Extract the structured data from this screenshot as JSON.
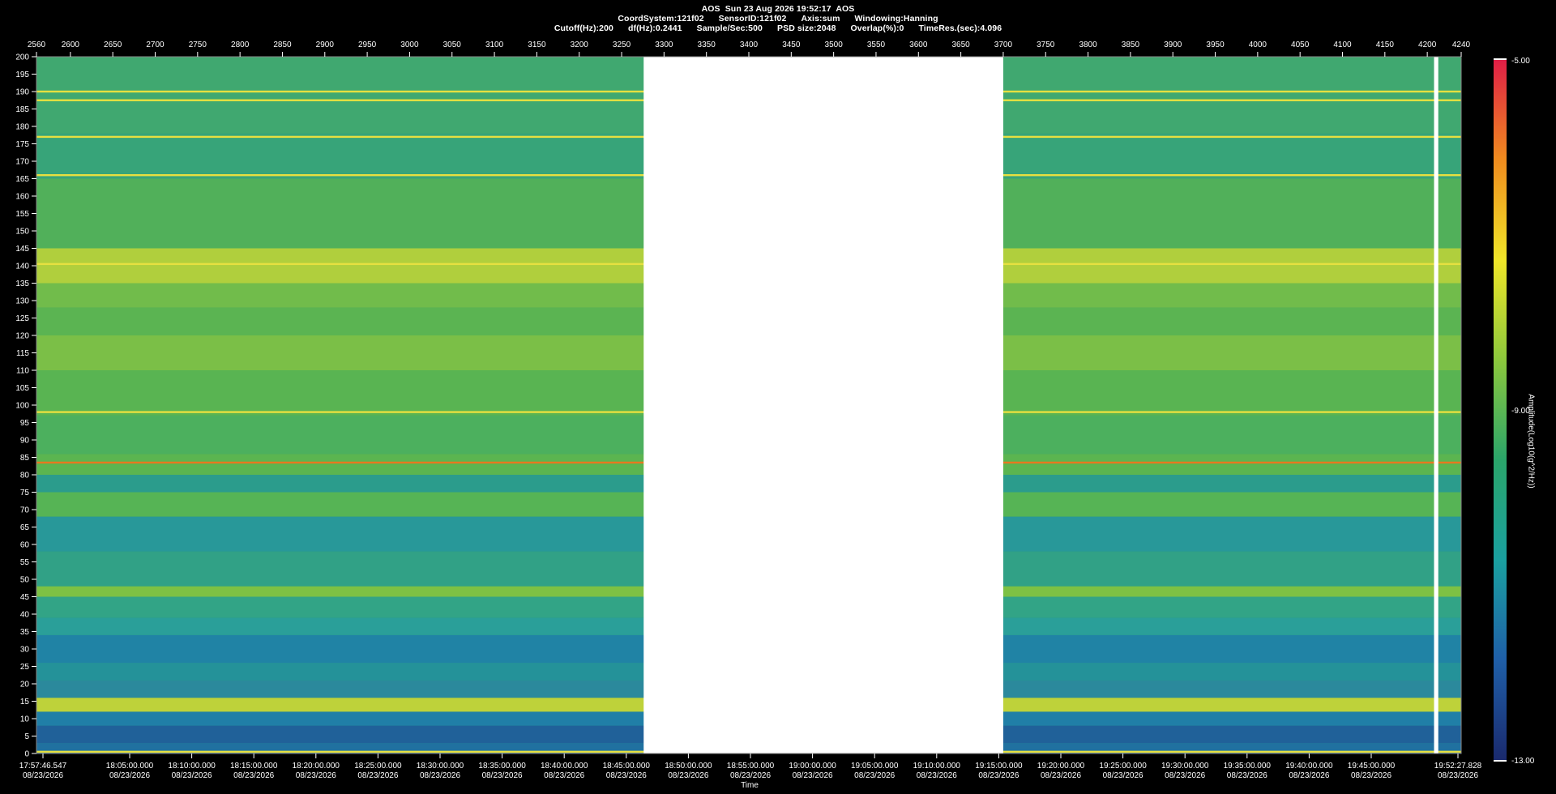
{
  "header": {
    "line1": [
      "AOS  Sun 23 Aug 2026 19:52:17  AOS"
    ],
    "line2": [
      "CoordSystem:121f02",
      "SensorID:121f02",
      "Axis:sum",
      "Windowing:Hanning"
    ],
    "line3": [
      "Cutoff(Hz):200",
      "df(Hz):0.2441",
      "Sample/Sec:500",
      "PSD size:2048",
      "Overlap(%):0",
      "TimeRes.(sec):4.096"
    ]
  },
  "chart_data": {
    "type": "heatmap",
    "title": "AOS  Sun 23 Aug 2026 19:52:17  AOS",
    "xlabel": "Time",
    "ylabel": "",
    "top_axis": {
      "range": [
        2560,
        4240
      ],
      "ticks": [
        2560,
        2600,
        2650,
        2700,
        2750,
        2800,
        2850,
        2900,
        2950,
        3000,
        3050,
        3100,
        3150,
        3200,
        3250,
        3300,
        3350,
        3400,
        3450,
        3500,
        3550,
        3600,
        3650,
        3700,
        3750,
        3800,
        3850,
        3900,
        3950,
        4000,
        4050,
        4100,
        4150,
        4200,
        4240
      ]
    },
    "y_axis": {
      "range": [
        0,
        200
      ],
      "ticks": [
        0,
        5,
        10,
        15,
        20,
        25,
        30,
        35,
        40,
        45,
        50,
        55,
        60,
        65,
        70,
        75,
        80,
        85,
        90,
        95,
        100,
        105,
        110,
        115,
        120,
        125,
        130,
        135,
        140,
        145,
        150,
        155,
        160,
        165,
        170,
        175,
        180,
        185,
        190,
        195,
        200
      ]
    },
    "x_axis": {
      "start_label": [
        "17:57:46.547",
        "08/23/2026"
      ],
      "end_label": [
        "19:52:27.828",
        "08/23/2026"
      ],
      "ticks": [
        [
          "18:05:00.000",
          "08/23/2026"
        ],
        [
          "18:10:00.000",
          "08/23/2026"
        ],
        [
          "18:15:00.000",
          "08/23/2026"
        ],
        [
          "18:20:00.000",
          "08/23/2026"
        ],
        [
          "18:25:00.000",
          "08/23/2026"
        ],
        [
          "18:30:00.000",
          "08/23/2026"
        ],
        [
          "18:35:00.000",
          "08/23/2026"
        ],
        [
          "18:40:00.000",
          "08/23/2026"
        ],
        [
          "18:45:00.000",
          "08/23/2026"
        ],
        [
          "18:50:00.000",
          "08/23/2026"
        ],
        [
          "18:55:00.000",
          "08/23/2026"
        ],
        [
          "19:00:00.000",
          "08/23/2026"
        ],
        [
          "19:05:00.000",
          "08/23/2026"
        ],
        [
          "19:10:00.000",
          "08/23/2026"
        ],
        [
          "19:15:00.000",
          "08/23/2026"
        ],
        [
          "19:20:00.000",
          "08/23/2026"
        ],
        [
          "19:25:00.000",
          "08/23/2026"
        ],
        [
          "19:30:00.000",
          "08/23/2026"
        ],
        [
          "19:35:00.000",
          "08/23/2026"
        ],
        [
          "19:40:00.000",
          "08/23/2026"
        ],
        [
          "19:45:00.000",
          "08/23/2026"
        ]
      ]
    },
    "data_gaps": [
      [
        3276,
        3700
      ],
      [
        4208,
        4213
      ]
    ],
    "persistent_lines_hz": [
      0.5,
      83.5,
      98,
      140.5,
      166,
      177,
      187.5,
      190
    ],
    "colorbar": {
      "title": "Amplitude(Log10(g^2/Hz))",
      "min": -13.0,
      "mid": -9.0,
      "max": -5.0,
      "min_label": "-13.00",
      "mid_label": "-9.00",
      "max_label": "-5.00",
      "colors": [
        "#1a2a6e",
        "#1f5fa8",
        "#1aa0a0",
        "#2aa56a",
        "#8cc83c",
        "#f0e628",
        "#f08c1e",
        "#e01e46"
      ]
    }
  }
}
